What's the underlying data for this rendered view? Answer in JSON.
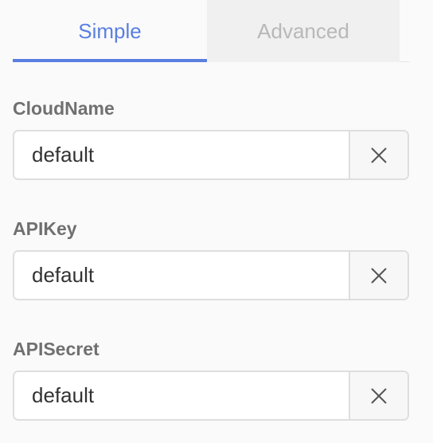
{
  "tabs": {
    "simple_label": "Simple",
    "advanced_label": "Advanced",
    "active": "Simple"
  },
  "fields": [
    {
      "label": "CloudName",
      "value": "default",
      "clear_icon": "close-icon"
    },
    {
      "label": "APIKey",
      "value": "default",
      "clear_icon": "close-icon"
    },
    {
      "label": "APISecret",
      "value": "default",
      "clear_icon": "close-icon"
    }
  ],
  "colors": {
    "accent": "#5a7fe0",
    "inactive_tab_text": "#b8b8b8",
    "label_text": "#707070"
  }
}
